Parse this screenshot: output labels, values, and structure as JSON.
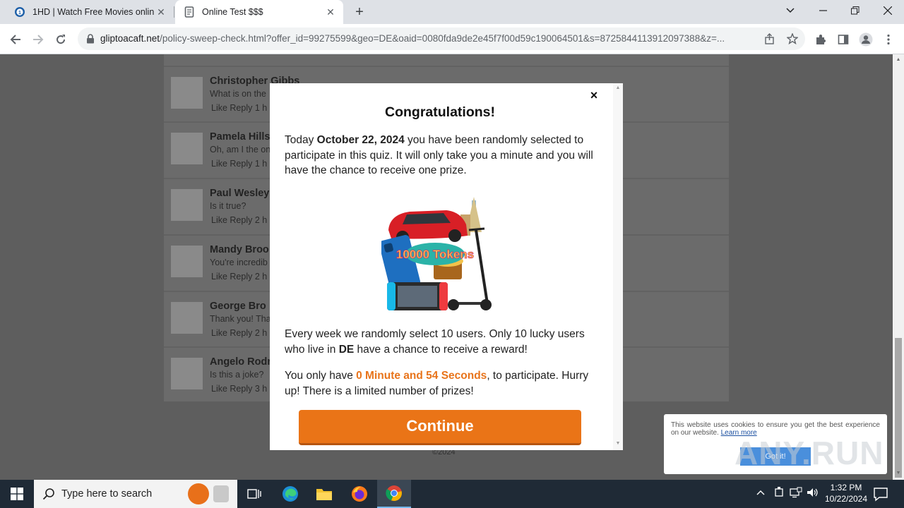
{
  "browser": {
    "tabs": [
      {
        "title": "1HD | Watch Free Movies online",
        "active": false
      },
      {
        "title": "Online Test $$$",
        "active": true
      }
    ],
    "url_host": "gliptoacaft.net",
    "url_path": "/policy-sweep-check.html?offer_id=99275599&geo=DE&oaid=0080fda9de2e45f7f00d59c190064501&s=8725844113912097388&z=..."
  },
  "comments": [
    {
      "name": "Christopher Gibbs",
      "text": "What is on the",
      "meta": "Like Reply  1 h"
    },
    {
      "name": "Pamela Hills",
      "text": "Oh, am I the on",
      "meta": "Like Reply  1 h"
    },
    {
      "name": "Paul Wesley",
      "text": "Is it true?",
      "meta": "Like Reply  2 h"
    },
    {
      "name": "Mandy Broo",
      "text": "You're incredib",
      "meta": "Like Reply  2 h"
    },
    {
      "name": "George Bro",
      "text": "Thank you! Tha",
      "meta": "Like Reply  2 h"
    },
    {
      "name": "Angelo Rodr",
      "text": "Is this a joke?",
      "meta": "Like Reply  3 h"
    }
  ],
  "footer": "©2024",
  "modal": {
    "title": "Congratulations!",
    "p1_a": "Today ",
    "p1_date": "October 22, 2024",
    "p1_b": " you have been randomly selected to participate in this quiz. It will only take you a minute and you will have the chance to receive one prize.",
    "image_tokens_text": "10000 Tokens",
    "p2_a": "Every week we randomly select 10 users. Only 10 lucky users who live in ",
    "p2_geo": "DE",
    "p2_b": " have a chance to receive a reward!",
    "p3_a": "You only have ",
    "p3_timer": "0 Minute and 54 Seconds",
    "p3_b": ", to participate. Hurry up! There is a limited number of prizes!",
    "button": "Continue",
    "accent_color": "#e8741b"
  },
  "cookie": {
    "text": "This website uses cookies to ensure you get the best experience on our website. ",
    "link": "Learn more",
    "button": "Got it!"
  },
  "watermark": "ANY.RUN",
  "taskbar": {
    "search_placeholder": "Type here to search",
    "time": "1:32 PM",
    "date": "10/22/2024"
  }
}
